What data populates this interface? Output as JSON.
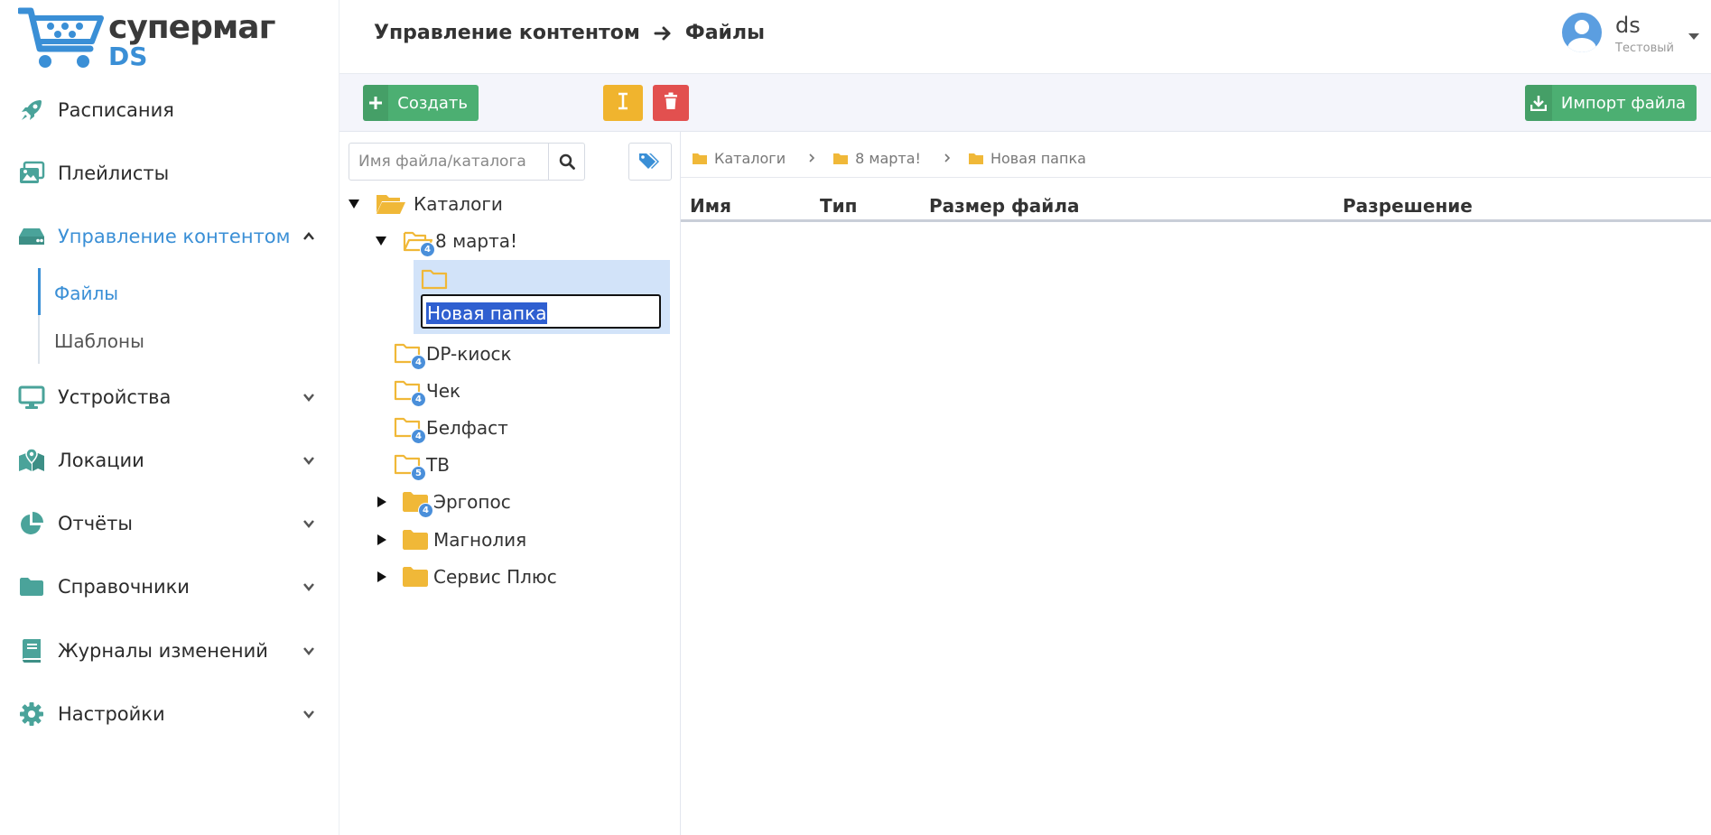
{
  "app": {
    "logo_line1": "супермаг",
    "logo_line2": "DS"
  },
  "sidebar": {
    "items": [
      {
        "label": "Расписания",
        "icon": "rocket-icon"
      },
      {
        "label": "Плейлисты",
        "icon": "images-icon"
      },
      {
        "label": "Управление контентом",
        "icon": "hdd-icon",
        "expanded": true
      },
      {
        "label": "Устройства",
        "icon": "monitor-icon"
      },
      {
        "label": "Локации",
        "icon": "map-marker-icon"
      },
      {
        "label": "Отчёты",
        "icon": "pie-chart-icon"
      },
      {
        "label": "Справочники",
        "icon": "folder-icon"
      },
      {
        "label": "Журналы изменений",
        "icon": "book-icon"
      },
      {
        "label": "Настройки",
        "icon": "gear-icon"
      }
    ],
    "subitems": [
      {
        "label": "Файлы",
        "active": true
      },
      {
        "label": "Шаблоны",
        "active": false
      }
    ]
  },
  "header": {
    "breadcrumb_section": "Управление контентом",
    "breadcrumb_page": "Файлы",
    "user_name": "ds",
    "user_role": "Тестовый"
  },
  "toolbar": {
    "create_label": "Создать",
    "import_label": "Импорт файла"
  },
  "tree": {
    "search_placeholder": "Имя файла/каталога",
    "root": "Каталоги",
    "nodes": [
      {
        "label": "8 марта!",
        "badge": "4"
      },
      {
        "label": "Новая папка"
      },
      {
        "label": "DP-киоск",
        "badge": "4"
      },
      {
        "label": "Чек",
        "badge": "4"
      },
      {
        "label": "Белфаст",
        "badge": "4"
      },
      {
        "label": "ТВ",
        "badge": "5"
      },
      {
        "label": "Эргопос",
        "badge": "4"
      },
      {
        "label": "Магнолия"
      },
      {
        "label": "Сервис Плюс"
      }
    ]
  },
  "files": {
    "path": [
      "Каталоги",
      "8 марта!",
      "Новая папка"
    ],
    "columns": [
      "Имя",
      "Тип",
      "Размер файла",
      "Разрешение"
    ]
  },
  "colors": {
    "accent": "#3a8fd6",
    "icon_teal": "#4aa39a",
    "folder": "#f0b838",
    "green": "#4caf72",
    "yellow": "#f0b42e",
    "red": "#e2504f"
  }
}
